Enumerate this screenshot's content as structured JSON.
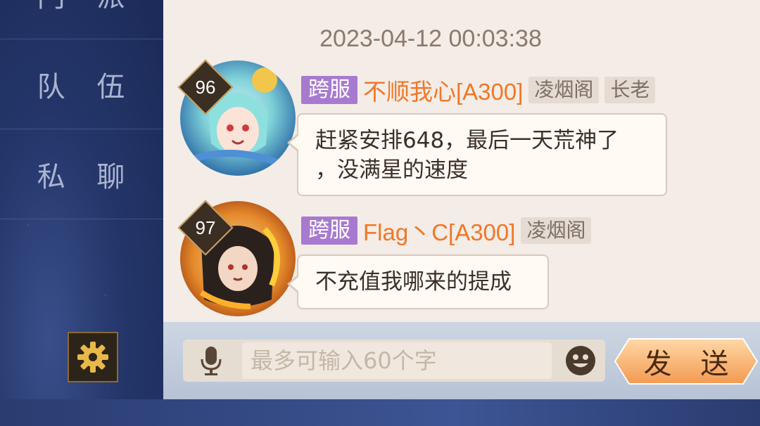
{
  "sidebar": {
    "items": [
      {
        "label": "门 派"
      },
      {
        "label": "队 伍"
      },
      {
        "label": "私 聊"
      }
    ],
    "settings_icon": "gear-icon"
  },
  "chat": {
    "timestamp": "2023-04-12 00:03:38",
    "messages": [
      {
        "level": "96",
        "server_tag": "跨服",
        "name": "不顺我心[A300]",
        "guild": "凌烟阁",
        "rank": "长老",
        "text_line1": "赶紧安排648，最后一天荒神了",
        "text_line2": "，没满星的速度"
      },
      {
        "level": "97",
        "server_tag": "跨服",
        "name": "Flag丶C[A300]",
        "guild": "凌烟阁",
        "text_line1": "不充值我哪来的提成"
      }
    ]
  },
  "input": {
    "placeholder": "最多可输入60个字",
    "value": "",
    "mic_icon": "microphone-icon",
    "emoji_icon": "smiley-icon",
    "send_label": "发 送"
  },
  "colors": {
    "server_tag": "#a77ad0",
    "player_name": "#f07828",
    "send_button": "#f7a762"
  }
}
